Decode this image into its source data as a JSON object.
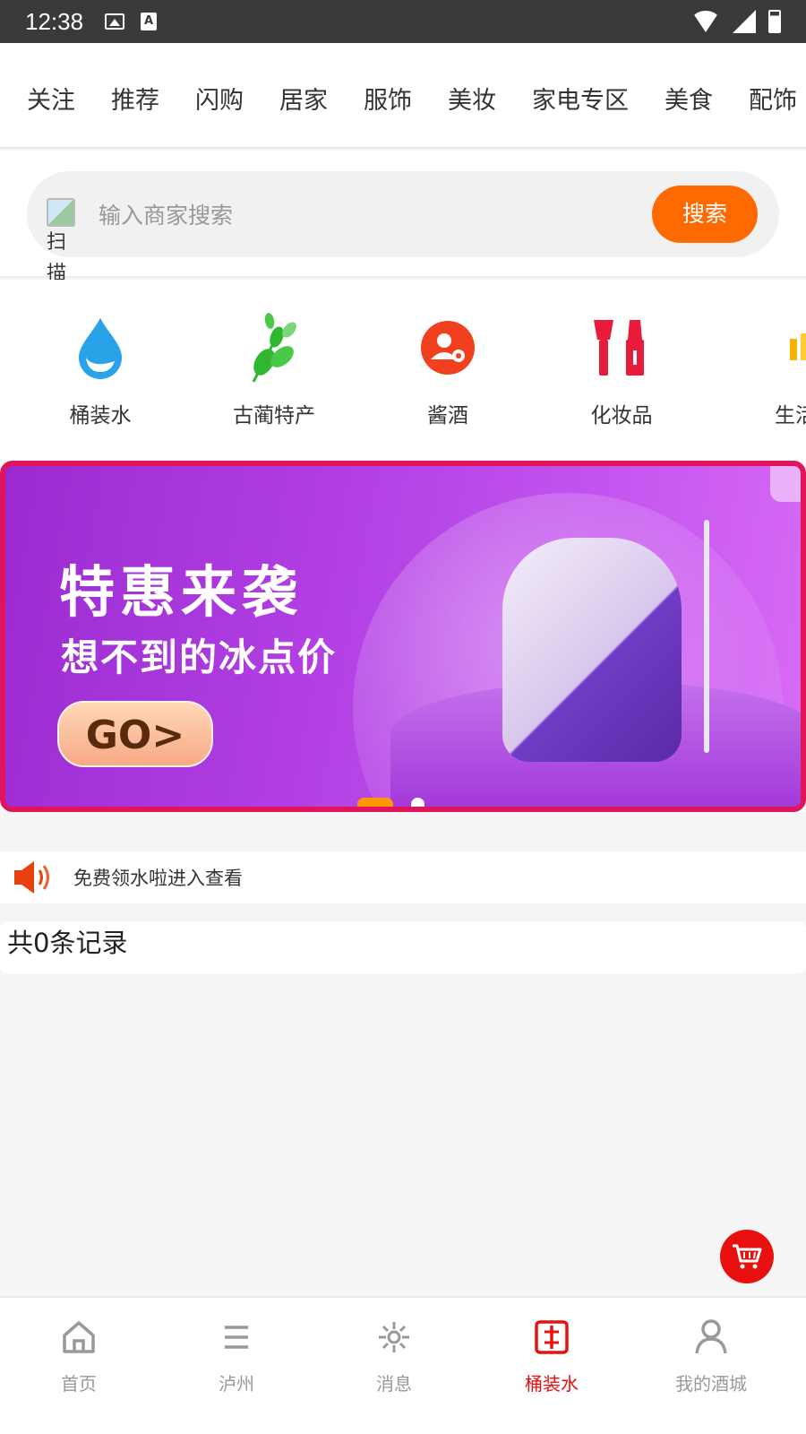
{
  "status_bar": {
    "time": "12:38"
  },
  "tabs": [
    "关注",
    "推荐",
    "闪购",
    "居家",
    "服饰",
    "美妆",
    "家电专区",
    "美食",
    "配饰"
  ],
  "search": {
    "scan_label": "扫描",
    "placeholder": "输入商家搜索",
    "button": "搜索"
  },
  "icons": [
    {
      "label": "桶装水",
      "icon": "water-drop-icon",
      "color": "#29a3e8"
    },
    {
      "label": "古蔺特产",
      "icon": "wheat-leaf-icon",
      "color": "#2fb82f"
    },
    {
      "label": "酱酒",
      "icon": "user-gear-icon",
      "color": "#f0401f"
    },
    {
      "label": "化妆品",
      "icon": "cosmetics-icon",
      "color": "#e81b3c"
    },
    {
      "label": "生活",
      "icon": "lifestyle-icon",
      "color": "#f5b400"
    }
  ],
  "banner": {
    "title": "特惠来袭",
    "subtitle": "想不到的冰点价",
    "cta": "GO>"
  },
  "notice": {
    "text": "免费领水啦进入查看"
  },
  "records": {
    "text": "共0条记录"
  },
  "bottom_nav": [
    {
      "label": "首页",
      "icon": "home-icon",
      "active": false
    },
    {
      "label": "泸州",
      "icon": "list-icon",
      "active": false
    },
    {
      "label": "消息",
      "icon": "sparkle-icon",
      "active": false
    },
    {
      "label": "桶装水",
      "icon": "bucket-water-icon",
      "active": true
    },
    {
      "label": "我的酒城",
      "icon": "person-icon",
      "active": false
    }
  ],
  "colors": {
    "accent": "#ff6a00",
    "active_nav": "#e8110f",
    "banner_border": "#e0145a"
  }
}
